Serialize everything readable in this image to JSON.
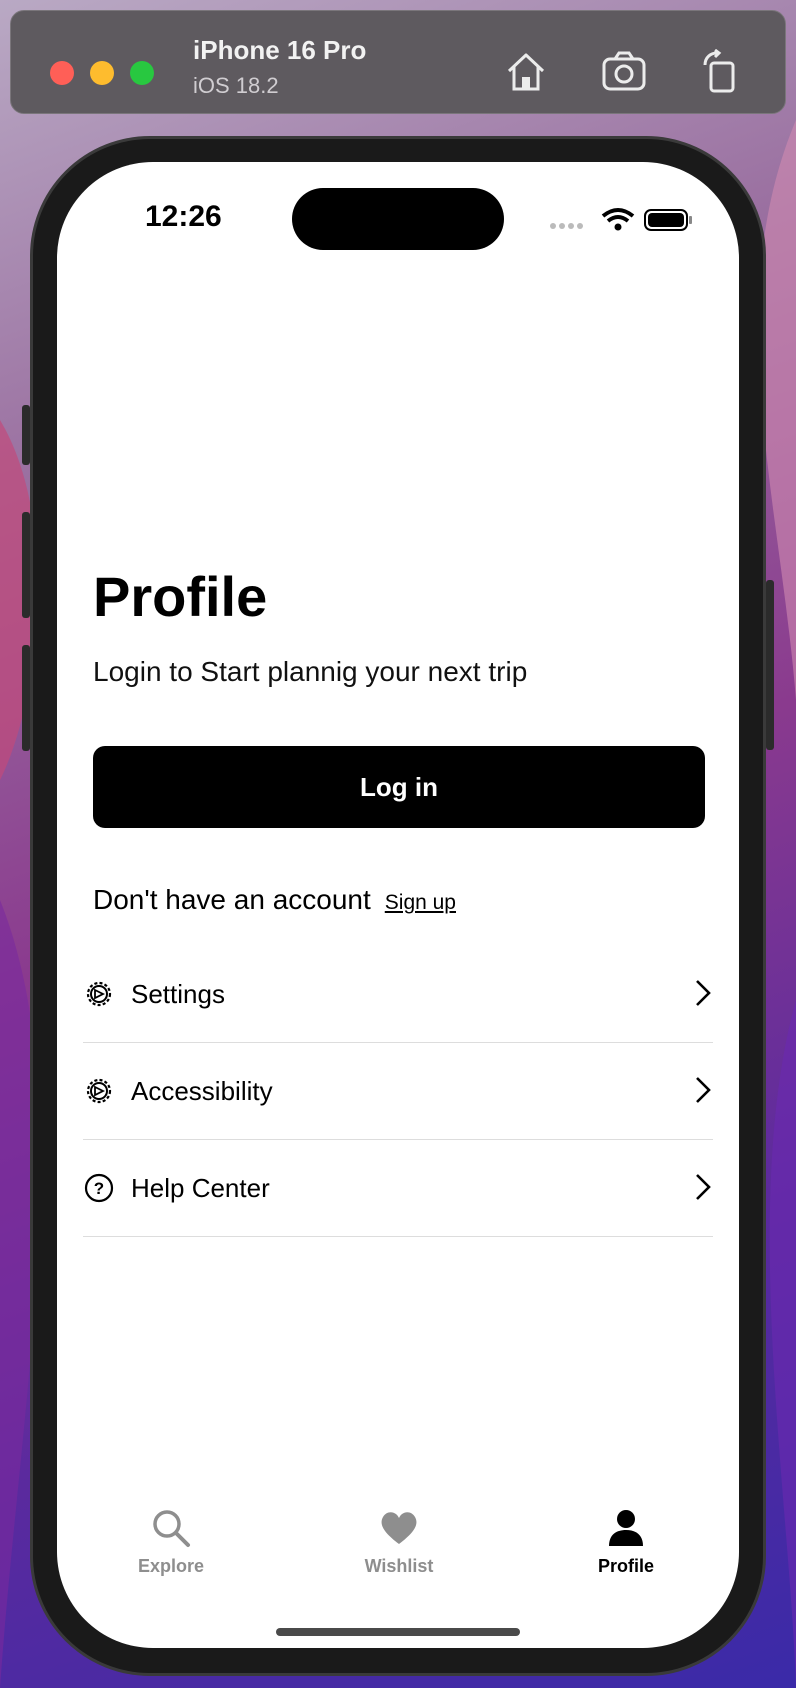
{
  "simulator": {
    "device_name": "iPhone 16 Pro",
    "os_version": "iOS 18.2",
    "toolbar_icons": [
      "home-icon",
      "screenshot-icon",
      "rotate-icon"
    ]
  },
  "status_bar": {
    "time": "12:26",
    "icons": [
      "cellular-icon",
      "wifi-icon",
      "battery-icon"
    ]
  },
  "profile": {
    "title": "Profile",
    "subtitle": "Login to Start plannig your next trip",
    "login_label": "Log in",
    "account_prompt": "Don't have an account",
    "signup_label": "Sign up"
  },
  "menu": {
    "items": [
      {
        "label": "Settings",
        "icon": "gear-icon"
      },
      {
        "label": "Accessibility",
        "icon": "gear-icon"
      },
      {
        "label": "Help Center",
        "icon": "question-circle-icon"
      }
    ]
  },
  "tabbar": {
    "items": [
      {
        "label": "Explore",
        "icon": "search-icon",
        "active": false
      },
      {
        "label": "Wishlist",
        "icon": "heart-icon",
        "active": false
      },
      {
        "label": "Profile",
        "icon": "person-icon",
        "active": true
      }
    ]
  },
  "colors": {
    "primary": "#000000",
    "inactive_tab": "#8e8e8e",
    "divider": "#dddddd",
    "background": "#ffffff"
  }
}
